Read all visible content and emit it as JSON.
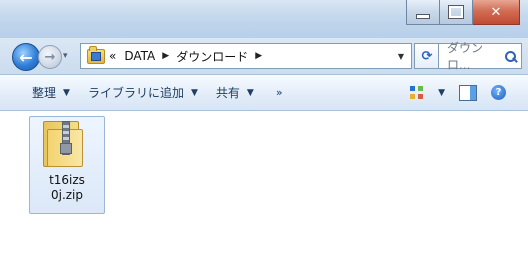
{
  "window": {
    "controls": [
      "minimize",
      "maximize",
      "close"
    ]
  },
  "nav": {
    "history_dropdown": "▾"
  },
  "address": {
    "prefix": "«",
    "breadcrumbs": [
      "DATA",
      "ダウンロード"
    ]
  },
  "search": {
    "placeholder": "ダウンロ..."
  },
  "toolbar": {
    "organize": "整理",
    "add_to_library": "ライブラリに追加",
    "share": "共有",
    "more": "»"
  },
  "files": [
    {
      "name_line1": "t16izs",
      "name_line2": "0j.zip",
      "icon": "zip-folder-icon"
    }
  ]
}
